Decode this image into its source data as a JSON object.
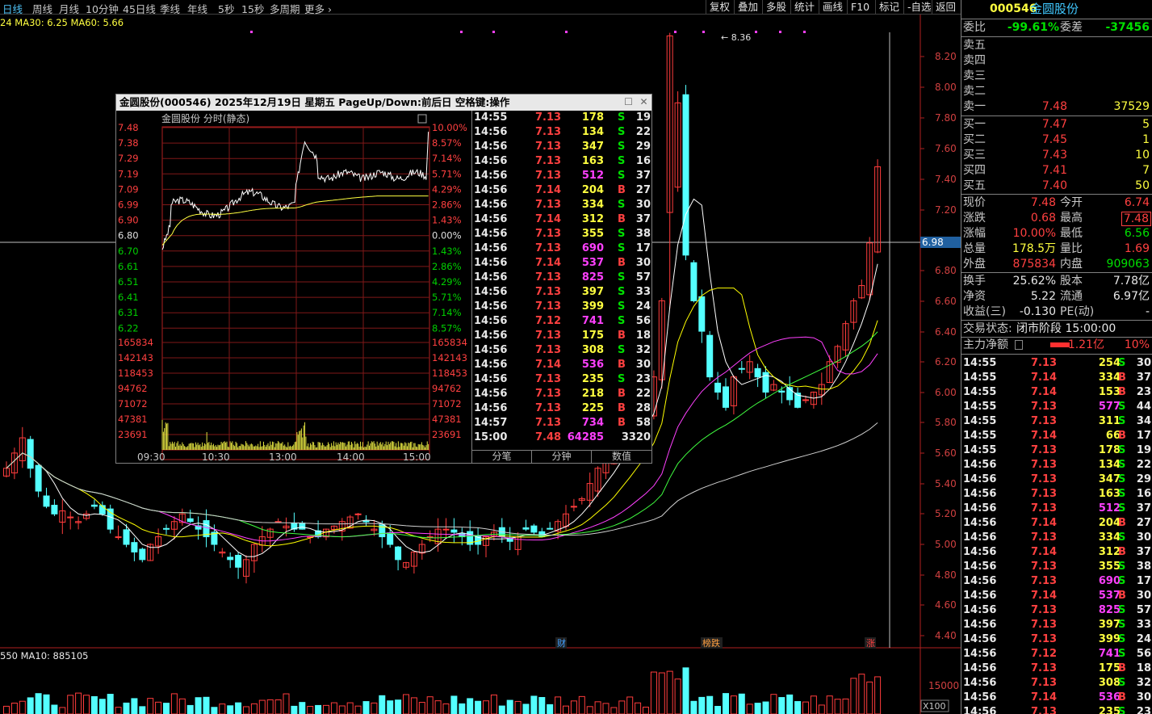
{
  "toolbar": {
    "periods": [
      "日线",
      "周线",
      "月线",
      "10分钟",
      "45日线",
      "季线",
      "年线",
      "5秒",
      "15秒",
      "多周期",
      "更多"
    ],
    "right_buttons": [
      "复权",
      "叠加",
      "多股",
      "统计",
      "画线",
      "F10",
      "标记",
      "-自选",
      "返回"
    ]
  },
  "chart": {
    "ma_legend": "24  MA30: 6.25  MA60: 5.66",
    "vol_legend": "550  MA10: 885105",
    "price_axis": [
      "8.20",
      "8.00",
      "7.80",
      "7.60",
      "7.40",
      "7.20",
      "6.98",
      "6.80",
      "6.60",
      "6.40",
      "6.20",
      "6.00",
      "5.80",
      "5.60",
      "5.40",
      "5.20",
      "5.00",
      "4.80",
      "4.60",
      "4.40"
    ],
    "crosshair_price": "6.98",
    "high_marker": "8.36",
    "vol_axis": [
      "15000"
    ],
    "vol_unit": "X100",
    "event_tags": [
      "财",
      "榜跌",
      "涨"
    ],
    "colors": {
      "up": "#ff3c3c",
      "down": "#54ffff",
      "ma5": "#ffffff",
      "ma10": "#ffff00",
      "ma20": "#ff40ff",
      "ma30": "#40ff40",
      "ma60": "#d0d0d0"
    }
  },
  "popup": {
    "title": "金圆股份(000546)  2025年12月19日  星期五  PageUp/Down:前后日  空格键:操作",
    "subtitle": "金圆股份   分时(静态)",
    "price_ticks": [
      "7.48",
      "7.38",
      "7.29",
      "7.19",
      "7.09",
      "6.99",
      "6.90",
      "6.80",
      "6.70",
      "6.61",
      "6.51",
      "6.41",
      "6.31",
      "6.22"
    ],
    "pct_ticks": [
      "10.00%",
      "8.57%",
      "7.14%",
      "5.71%",
      "4.29%",
      "2.86%",
      "1.43%",
      "0.00%",
      "1.43%",
      "2.86%",
      "4.29%",
      "5.71%",
      "7.14%",
      "8.57%"
    ],
    "vol_ticks": [
      "165834",
      "142143",
      "118453",
      "94762",
      "71072",
      "47381",
      "23691"
    ],
    "time_ticks": [
      "09:30",
      "10:30",
      "13:00",
      "14:00",
      "15:00"
    ],
    "trades": [
      {
        "t": "14:55",
        "p": "7.13",
        "v": "178",
        "d": "S",
        "n": "19"
      },
      {
        "t": "14:56",
        "p": "7.13",
        "v": "134",
        "d": "S",
        "n": "22"
      },
      {
        "t": "14:56",
        "p": "7.13",
        "v": "347",
        "d": "S",
        "n": "29"
      },
      {
        "t": "14:56",
        "p": "7.13",
        "v": "163",
        "d": "S",
        "n": "16"
      },
      {
        "t": "14:56",
        "p": "7.13",
        "v": "512",
        "d": "S",
        "n": "37"
      },
      {
        "t": "14:56",
        "p": "7.14",
        "v": "204",
        "d": "B",
        "n": "27"
      },
      {
        "t": "14:56",
        "p": "7.13",
        "v": "334",
        "d": "S",
        "n": "30"
      },
      {
        "t": "14:56",
        "p": "7.14",
        "v": "312",
        "d": "B",
        "n": "37"
      },
      {
        "t": "14:56",
        "p": "7.13",
        "v": "355",
        "d": "S",
        "n": "38"
      },
      {
        "t": "14:56",
        "p": "7.13",
        "v": "690",
        "d": "S",
        "n": "17"
      },
      {
        "t": "14:56",
        "p": "7.14",
        "v": "537",
        "d": "B",
        "n": "30"
      },
      {
        "t": "14:56",
        "p": "7.13",
        "v": "825",
        "d": "S",
        "n": "57"
      },
      {
        "t": "14:56",
        "p": "7.13",
        "v": "397",
        "d": "S",
        "n": "33"
      },
      {
        "t": "14:56",
        "p": "7.13",
        "v": "399",
        "d": "S",
        "n": "24"
      },
      {
        "t": "14:56",
        "p": "7.12",
        "v": "741",
        "d": "S",
        "n": "56"
      },
      {
        "t": "14:56",
        "p": "7.13",
        "v": "175",
        "d": "B",
        "n": "18"
      },
      {
        "t": "14:56",
        "p": "7.13",
        "v": "308",
        "d": "S",
        "n": "32"
      },
      {
        "t": "14:56",
        "p": "7.14",
        "v": "536",
        "d": "B",
        "n": "30"
      },
      {
        "t": "14:56",
        "p": "7.13",
        "v": "235",
        "d": "S",
        "n": "23"
      },
      {
        "t": "14:56",
        "p": "7.13",
        "v": "218",
        "d": "B",
        "n": "22"
      },
      {
        "t": "14:56",
        "p": "7.13",
        "v": "225",
        "d": "B",
        "n": "28"
      },
      {
        "t": "14:57",
        "p": "7.13",
        "v": "734",
        "d": "B",
        "n": "58"
      },
      {
        "t": "15:00",
        "p": "7.48",
        "v": "64285",
        "d": "",
        "n": "3320"
      }
    ],
    "tabs": [
      "分笔",
      "分钟",
      "数值"
    ]
  },
  "quote": {
    "code": "000546",
    "name": "金圆股份",
    "weibi_label": "委比",
    "weibi": "-99.61%",
    "weicha_label": "委差",
    "weicha": "-37456",
    "asks": [
      {
        "label": "卖五",
        "price": "",
        "vol": ""
      },
      {
        "label": "卖四",
        "price": "",
        "vol": ""
      },
      {
        "label": "卖三",
        "price": "",
        "vol": ""
      },
      {
        "label": "卖二",
        "price": "",
        "vol": ""
      },
      {
        "label": "卖一",
        "price": "7.48",
        "vol": "37529"
      }
    ],
    "bids": [
      {
        "label": "买一",
        "price": "7.47",
        "vol": "5"
      },
      {
        "label": "买二",
        "price": "7.45",
        "vol": "1"
      },
      {
        "label": "买三",
        "price": "7.43",
        "vol": "10"
      },
      {
        "label": "买四",
        "price": "7.41",
        "vol": "7"
      },
      {
        "label": "买五",
        "price": "7.40",
        "vol": "50"
      }
    ],
    "stats": [
      {
        "l1": "现价",
        "v1": "7.48",
        "c1": "red",
        "l2": "今开",
        "v2": "6.74",
        "c2": "red"
      },
      {
        "l1": "涨跌",
        "v1": "0.68",
        "c1": "red",
        "l2": "最高",
        "v2": "7.48",
        "c2": "red"
      },
      {
        "l1": "涨幅",
        "v1": "10.00%",
        "c1": "red",
        "l2": "最低",
        "v2": "6.56",
        "c2": "green"
      },
      {
        "l1": "总量",
        "v1": "178.5万",
        "c1": "yellow",
        "l2": "量比",
        "v2": "1.69",
        "c2": "red"
      },
      {
        "l1": "外盘",
        "v1": "875834",
        "c1": "red",
        "l2": "内盘",
        "v2": "909063",
        "c2": "green"
      }
    ],
    "stats2": [
      {
        "l1": "换手",
        "v1": "25.62%",
        "l2": "股本",
        "v2": "7.78亿"
      },
      {
        "l1": "净资",
        "v1": "5.22",
        "l2": "流通",
        "v2": "6.97亿"
      },
      {
        "l1": "收益(三)",
        "v1": "-0.130",
        "l2": "PE(动)",
        "v2": "-"
      }
    ],
    "status_label": "交易状态:",
    "status": "闭市阶段 15:00:00",
    "mainflow_label": "主力净额",
    "mainflow": "1.21亿",
    "mainflow_pct": "10%"
  },
  "ticks": [
    {
      "t": "14:55",
      "p": "7.13",
      "v": "254",
      "d": "S",
      "n": "30"
    },
    {
      "t": "14:55",
      "p": "7.14",
      "v": "334",
      "d": "B",
      "n": "37"
    },
    {
      "t": "14:55",
      "p": "7.14",
      "v": "153",
      "d": "B",
      "n": "23"
    },
    {
      "t": "14:55",
      "p": "7.13",
      "v": "577",
      "d": "S",
      "n": "44"
    },
    {
      "t": "14:55",
      "p": "7.13",
      "v": "311",
      "d": "S",
      "n": "34"
    },
    {
      "t": "14:55",
      "p": "7.14",
      "v": "66",
      "d": "B",
      "n": "17"
    },
    {
      "t": "14:55",
      "p": "7.13",
      "v": "178",
      "d": "S",
      "n": "19"
    },
    {
      "t": "14:56",
      "p": "7.13",
      "v": "134",
      "d": "S",
      "n": "22"
    },
    {
      "t": "14:56",
      "p": "7.13",
      "v": "347",
      "d": "S",
      "n": "29"
    },
    {
      "t": "14:56",
      "p": "7.13",
      "v": "163",
      "d": "S",
      "n": "16"
    },
    {
      "t": "14:56",
      "p": "7.13",
      "v": "512",
      "d": "S",
      "n": "37"
    },
    {
      "t": "14:56",
      "p": "7.14",
      "v": "204",
      "d": "B",
      "n": "27"
    },
    {
      "t": "14:56",
      "p": "7.13",
      "v": "334",
      "d": "S",
      "n": "30"
    },
    {
      "t": "14:56",
      "p": "7.14",
      "v": "312",
      "d": "B",
      "n": "37"
    },
    {
      "t": "14:56",
      "p": "7.13",
      "v": "355",
      "d": "S",
      "n": "38"
    },
    {
      "t": "14:56",
      "p": "7.13",
      "v": "690",
      "d": "S",
      "n": "17"
    },
    {
      "t": "14:56",
      "p": "7.14",
      "v": "537",
      "d": "B",
      "n": "30"
    },
    {
      "t": "14:56",
      "p": "7.13",
      "v": "825",
      "d": "S",
      "n": "57"
    },
    {
      "t": "14:56",
      "p": "7.13",
      "v": "397",
      "d": "S",
      "n": "33"
    },
    {
      "t": "14:56",
      "p": "7.13",
      "v": "399",
      "d": "S",
      "n": "24"
    },
    {
      "t": "14:56",
      "p": "7.12",
      "v": "741",
      "d": "S",
      "n": "56"
    },
    {
      "t": "14:56",
      "p": "7.13",
      "v": "175",
      "d": "B",
      "n": "18"
    },
    {
      "t": "14:56",
      "p": "7.13",
      "v": "308",
      "d": "S",
      "n": "32"
    },
    {
      "t": "14:56",
      "p": "7.14",
      "v": "536",
      "d": "B",
      "n": "30"
    },
    {
      "t": "14:56",
      "p": "7.13",
      "v": "235",
      "d": "S",
      "n": "23"
    }
  ]
}
